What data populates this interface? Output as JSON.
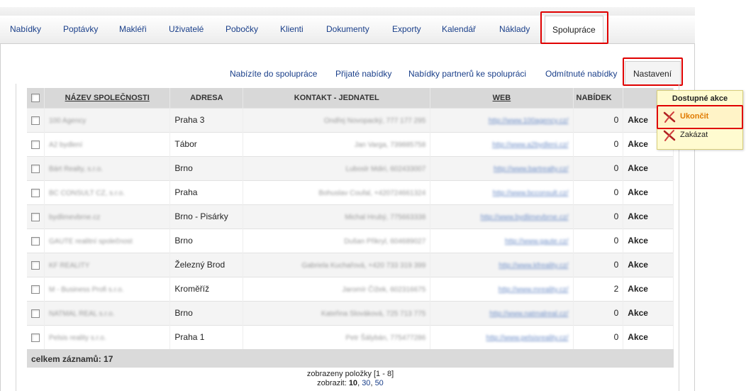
{
  "tabs": [
    {
      "label": "Nabídky"
    },
    {
      "label": "Poptávky"
    },
    {
      "label": "Makléři"
    },
    {
      "label": "Uživatelé"
    },
    {
      "label": "Pobočky"
    },
    {
      "label": "Klienti"
    },
    {
      "label": "Dokumenty"
    },
    {
      "label": "Exporty"
    },
    {
      "label": "Kalendář"
    },
    {
      "label": "Náklady"
    },
    {
      "label": "Spolupráce"
    }
  ],
  "subnav": {
    "items": [
      "Nabízíte do spolupráce",
      "Přijaté nabídky",
      "Nabídky partnerů ke spolupráci",
      "Odmítnuté nabídky"
    ],
    "active": "Nastavení"
  },
  "table": {
    "headers": {
      "name": "NÁZEV SPOLEČNOSTI",
      "address": "ADRESA",
      "contact": "KONTAKT - JEDNATEL",
      "web": "WEB",
      "offers": "NABÍDEK"
    },
    "rows": [
      {
        "name": "100 Agency",
        "address": "Praha 3",
        "contact": "Ondřej Novopacký, 777 177 295",
        "web": "http://www.100agency.cz/",
        "offers": "0",
        "action": "Akce"
      },
      {
        "name": "A2 bydlení",
        "address": "Tábor",
        "contact": "Jan Varga, 739885758",
        "web": "http://www.a2bydleni.cz/",
        "offers": "0",
        "action": "Akce"
      },
      {
        "name": "Bárt Realty, s.r.o.",
        "address": "Brno",
        "contact": "Luboslr Mdiri, 602433007",
        "web": "http://www.bartrealty.cz/",
        "offers": "0",
        "action": "Akce"
      },
      {
        "name": "BC CONSULT CZ, s.r.o.",
        "address": "Praha",
        "contact": "Bohuslav Coufal, +420724661324",
        "web": "http://www.bcconsult.cz/",
        "offers": "0",
        "action": "Akce"
      },
      {
        "name": "bydlimevbrne.cz",
        "address": "Brno - Pisárky",
        "contact": "Michal Hrubý, 775663338",
        "web": "http://www.bydlimevbrne.cz/",
        "offers": "0",
        "action": "Akce"
      },
      {
        "name": "GAUTE realitní společnost",
        "address": "Brno",
        "contact": "Dušan Přikryl, 604689027",
        "web": "http://www.gaute.cz/",
        "offers": "0",
        "action": "Akce"
      },
      {
        "name": "KF REALITY",
        "address": "Železný Brod",
        "contact": "Gabriela Kuchařová, +420 733 319 399",
        "web": "http://www.kfreality.cz/",
        "offers": "0",
        "action": "Akce"
      },
      {
        "name": "M - Business Profi s.r.o.",
        "address": "Kroměříž",
        "contact": "Jaromír Čížek, 602316675",
        "web": "http://www.mreality.cz/",
        "offers": "2",
        "action": "Akce"
      },
      {
        "name": "NATMAL REAL s.r.o.",
        "address": "Brno",
        "contact": "Kateřina Slováková, 725 713 775",
        "web": "http://www.natmalreal.cz/",
        "offers": "0",
        "action": "Akce"
      },
      {
        "name": "Pelsis reality s.r.o.",
        "address": "Praha 1",
        "contact": "Petr Šálybán, 775477286",
        "web": "http://www.pelsisreality.cz/",
        "offers": "0",
        "action": "Akce"
      }
    ],
    "total_label": "celkem záznamů: 17"
  },
  "pager": {
    "shown_label": "zobrazeny položky [1 - 8]",
    "show_label": "zobrazit:",
    "sizes": [
      "10",
      "30",
      "50"
    ],
    "current_size": "10"
  },
  "popup": {
    "title": "Dostupné akce",
    "items": [
      "Ukončit",
      "Zakázat"
    ]
  },
  "colors": {
    "highlight": "#e00000",
    "link": "#1a3f8a",
    "popup_bg": "#fffbd0",
    "popup_selected_text": "#e07a00"
  }
}
